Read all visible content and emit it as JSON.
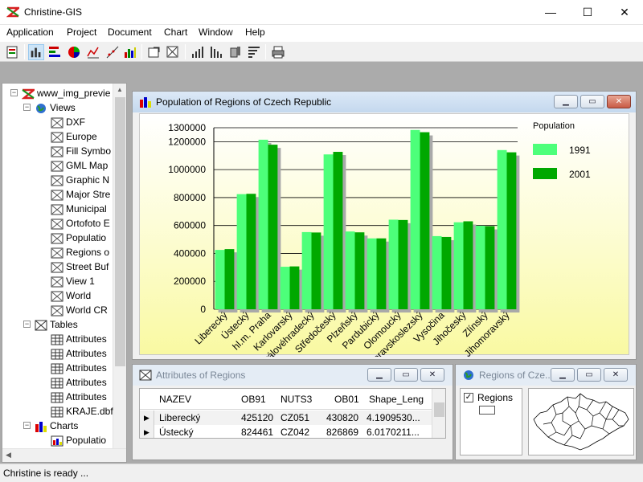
{
  "app": {
    "title": "Christine-GIS",
    "window_buttons": [
      "—",
      "☐",
      "✕"
    ]
  },
  "menu": [
    "Application",
    "Project",
    "Document",
    "Chart",
    "Window",
    "Help"
  ],
  "tree": {
    "root": "www_img_previe",
    "items": [
      {
        "label": "Views",
        "kind": "group",
        "level": 1
      },
      {
        "label": "DXF",
        "kind": "view",
        "level": 2
      },
      {
        "label": "Europe",
        "kind": "view",
        "level": 2
      },
      {
        "label": "Fill Symbo",
        "kind": "view",
        "level": 2
      },
      {
        "label": "GML Map",
        "kind": "view",
        "level": 2
      },
      {
        "label": "Graphic N",
        "kind": "view",
        "level": 2
      },
      {
        "label": "Major Stre",
        "kind": "view",
        "level": 2
      },
      {
        "label": "Municipal",
        "kind": "view",
        "level": 2
      },
      {
        "label": "Ortofoto E",
        "kind": "view",
        "level": 2
      },
      {
        "label": "Populatio",
        "kind": "view",
        "level": 2
      },
      {
        "label": "Regions o",
        "kind": "view",
        "level": 2
      },
      {
        "label": "Street Buf",
        "kind": "view",
        "level": 2
      },
      {
        "label": "View 1",
        "kind": "view",
        "level": 2
      },
      {
        "label": "World",
        "kind": "view",
        "level": 2
      },
      {
        "label": "World CR",
        "kind": "view",
        "level": 2
      },
      {
        "label": "Tables",
        "kind": "group",
        "level": 1
      },
      {
        "label": "Attributes",
        "kind": "table",
        "level": 2
      },
      {
        "label": "Attributes",
        "kind": "table",
        "level": 2
      },
      {
        "label": "Attributes",
        "kind": "table",
        "level": 2
      },
      {
        "label": "Attributes",
        "kind": "table",
        "level": 2
      },
      {
        "label": "Attributes",
        "kind": "table",
        "level": 2
      },
      {
        "label": "KRAJE.dbf",
        "kind": "table",
        "level": 2
      },
      {
        "label": "Charts",
        "kind": "group",
        "level": 1
      },
      {
        "label": "Populatio",
        "kind": "chart",
        "level": 2
      }
    ]
  },
  "chart_window": {
    "title": "Population of Regions of Czech Republic"
  },
  "chart_data": {
    "type": "bar",
    "title": "",
    "categories": [
      "Liberecký",
      "Ústecký",
      "hl.m. Praha",
      "Karlovarský",
      "Královéhradecký",
      "Středočeský",
      "Plzeňský",
      "Pardubický",
      "Olomoucký",
      "Moravskoslezský",
      "Vysočina",
      "Jihočeský",
      "Zlínský",
      "Jihomoravský"
    ],
    "series": [
      {
        "name": "1991",
        "color": "#4dff7a",
        "values": [
          425120,
          824461,
          1214174,
          304588,
          552720,
          1108962,
          557058,
          507713,
          641637,
          1284000,
          524000,
          623000,
          598000,
          1140000
        ]
      },
      {
        "name": "2001",
        "color": "#00a800",
        "values": [
          430820,
          826869,
          1178576,
          307022,
          549839,
          1127311,
          550954,
          507792,
          639369,
          1268000,
          518000,
          630000,
          595000,
          1124000
        ]
      }
    ],
    "ylim": [
      0,
      1300000
    ],
    "yticks": [
      0,
      200000,
      400000,
      600000,
      800000,
      1000000,
      1200000,
      1300000
    ],
    "legend_title": "Population",
    "legend_position": "right",
    "grid": true
  },
  "attributes_window": {
    "title": "Attributes of Regions",
    "columns": [
      "NAZEV",
      "OB91",
      "NUTS3",
      "OB01",
      "Shape_Leng"
    ],
    "rows": [
      [
        "Liberecký",
        "425120",
        "CZ051",
        "430820",
        "4.1909530..."
      ],
      [
        "Ústecký",
        "824461",
        "CZ042",
        "826869",
        "6.0170211..."
      ]
    ]
  },
  "map_window": {
    "title": "Regions of Cze...",
    "layer": "Regions",
    "layer_checked": true
  },
  "status": "Christine is ready ..."
}
